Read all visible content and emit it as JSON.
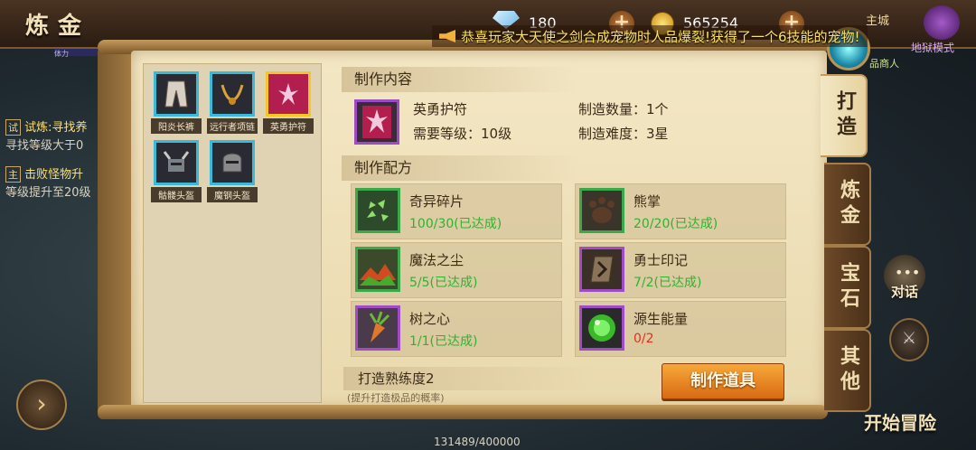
{
  "header": {
    "title": "炼金",
    "diamonds": "180",
    "gold": "565254",
    "plus": "+",
    "notice": "恭喜玩家大天使之剑合成宠物时人品爆裂!获得了一个6技能的宠物!",
    "main_city": "主城",
    "hell_mode": "地狱模式",
    "merchant": "品商人"
  },
  "background": {
    "hp_label": "体力",
    "quests": [
      {
        "tag": "试",
        "title": "试炼:寻找养",
        "desc": "寻找等级大于0"
      },
      {
        "tag": "主",
        "title": "击败怪物升",
        "desc": "等级提升至20级"
      }
    ],
    "exp": "131489/400000",
    "start_adventure": "开始冒险",
    "chat": "对话",
    "go_arrow": "›"
  },
  "item_list": [
    {
      "name": "阳炎长裤",
      "selected": false
    },
    {
      "name": "远行者项链",
      "selected": false
    },
    {
      "name": "英勇护符",
      "selected": true
    },
    {
      "name": "骷髅头盔",
      "selected": false
    },
    {
      "name": "魔钢头盔",
      "selected": false
    }
  ],
  "product": {
    "section_title": "制作内容",
    "name": "英勇护符",
    "level": "需要等级：10级",
    "quantity": "制造数量：1个",
    "difficulty": "制造难度：3星"
  },
  "recipe": {
    "section_title": "制作配方",
    "materials": [
      {
        "name": "奇异碎片",
        "count": "100/30(已达成)",
        "done": true,
        "quality": "green"
      },
      {
        "name": "熊掌",
        "count": "20/20(已达成)",
        "done": true,
        "quality": "green"
      },
      {
        "name": "魔法之尘",
        "count": "5/5(已达成)",
        "done": true,
        "quality": "green"
      },
      {
        "name": "勇士印记",
        "count": "7/2(已达成)",
        "done": true,
        "quality": "purple"
      },
      {
        "name": "树之心",
        "count": "1/1(已达成)",
        "done": true,
        "quality": "purple"
      },
      {
        "name": "源生能量",
        "count": "0/2",
        "done": false,
        "quality": "purple"
      }
    ]
  },
  "footer": {
    "proficiency": "打造熟练度2",
    "hint": "(提升打造极品的概率)",
    "make_button": "制作道具"
  },
  "tabs": [
    {
      "label": "打造",
      "active": true
    },
    {
      "label": "炼金",
      "active": false
    },
    {
      "label": "宝石",
      "active": false
    },
    {
      "label": "其他",
      "active": false
    }
  ]
}
